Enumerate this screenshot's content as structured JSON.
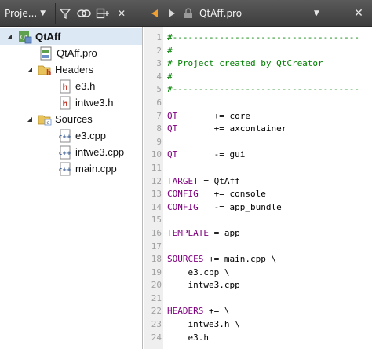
{
  "toolbar": {
    "project_selector": "Proje...",
    "filter_tooltip": "filter",
    "link_tooltip": "synchronize",
    "split_tooltip": "split",
    "close_glyph": "✕"
  },
  "editor_toolbar": {
    "file_title": "QtAff.pro",
    "close_glyph": "✕"
  },
  "tree": {
    "root": "QtAff",
    "items": [
      {
        "label": "QtAff.pro",
        "kind": "pro"
      },
      {
        "label": "Headers",
        "kind": "folder-h"
      },
      {
        "label": "e3.h",
        "kind": "h"
      },
      {
        "label": "intwe3.h",
        "kind": "h"
      },
      {
        "label": "Sources",
        "kind": "folder-cpp"
      },
      {
        "label": "e3.cpp",
        "kind": "cpp"
      },
      {
        "label": "intwe3.cpp",
        "kind": "cpp"
      },
      {
        "label": "main.cpp",
        "kind": "cpp"
      }
    ]
  },
  "code": {
    "lines": [
      {
        "n": "1",
        "text": "#------------------------------------",
        "kind": "cmt"
      },
      {
        "n": "2",
        "text": "#",
        "kind": "cmt"
      },
      {
        "n": "3",
        "text": "# Project created by QtCreator",
        "kind": "cmt"
      },
      {
        "n": "4",
        "text": "#",
        "kind": "cmt"
      },
      {
        "n": "5",
        "text": "#------------------------------------",
        "kind": "cmt"
      },
      {
        "n": "6",
        "text": "",
        "kind": "def"
      },
      {
        "n": "7",
        "var": "QT",
        "rest": "       += core"
      },
      {
        "n": "8",
        "var": "QT",
        "rest": "       += axcontainer"
      },
      {
        "n": "9",
        "text": "",
        "kind": "def"
      },
      {
        "n": "10",
        "var": "QT",
        "rest": "       -= gui"
      },
      {
        "n": "11",
        "text": "",
        "kind": "def"
      },
      {
        "n": "12",
        "var": "TARGET",
        "rest": " = QtAff"
      },
      {
        "n": "13",
        "var": "CONFIG",
        "rest": "   += console"
      },
      {
        "n": "14",
        "var": "CONFIG",
        "rest": "   -= app_bundle"
      },
      {
        "n": "15",
        "text": "",
        "kind": "def"
      },
      {
        "n": "16",
        "var": "TEMPLATE",
        "rest": " = app"
      },
      {
        "n": "17",
        "text": "",
        "kind": "def"
      },
      {
        "n": "18",
        "var": "SOURCES",
        "rest": " += main.cpp \\"
      },
      {
        "n": "19",
        "text": "    e3.cpp \\",
        "kind": "def"
      },
      {
        "n": "20",
        "text": "    intwe3.cpp",
        "kind": "def"
      },
      {
        "n": "21",
        "text": "",
        "kind": "def"
      },
      {
        "n": "22",
        "var": "HEADERS",
        "rest": " += \\"
      },
      {
        "n": "23",
        "text": "    intwe3.h \\",
        "kind": "def"
      },
      {
        "n": "24",
        "text": "    e3.h",
        "kind": "def"
      }
    ]
  },
  "colors": {
    "toolbar_bg": "#4a4a4a",
    "comment": "#008000",
    "variable": "#800080",
    "selection": "#dde8f5",
    "gutter": "#efefef"
  }
}
